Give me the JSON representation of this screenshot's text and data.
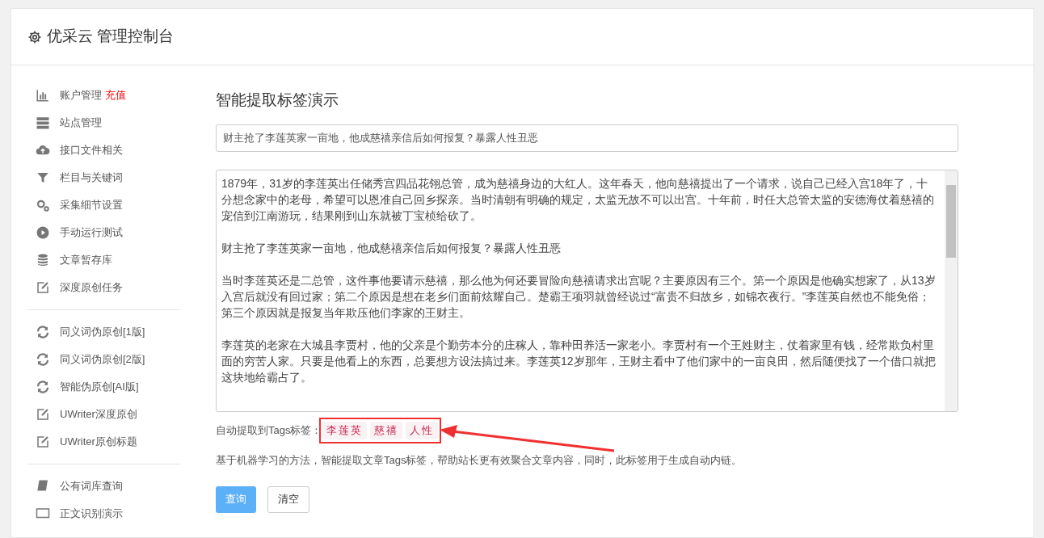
{
  "header": {
    "title": "优采云 管理控制台"
  },
  "sidebar": {
    "groups": [
      [
        {
          "label": "账户管理",
          "badge": "充值"
        },
        {
          "label": "站点管理"
        },
        {
          "label": "接口文件相关"
        },
        {
          "label": "栏目与关键词"
        },
        {
          "label": "采集细节设置"
        },
        {
          "label": "手动运行测试"
        },
        {
          "label": "文章暂存库"
        },
        {
          "label": "深度原创任务"
        }
      ],
      [
        {
          "label": "同义词伪原创[1版]"
        },
        {
          "label": "同义词伪原创[2版]"
        },
        {
          "label": "智能伪原创[AI版]"
        },
        {
          "label": "UWriter深度原创"
        },
        {
          "label": "UWriter原创标题"
        }
      ],
      [
        {
          "label": "公有词库查询"
        },
        {
          "label": "正文识别演示"
        }
      ]
    ]
  },
  "main": {
    "heading": "智能提取标签演示",
    "title_field": {
      "value": "财主抢了李莲英家一亩地，他成慈禧亲信后如何报复？暴露人性丑恶"
    },
    "content": [
      "1879年，31岁的李莲英出任储秀宫四品花翎总管，成为慈禧身边的大红人。这年春天，他向慈禧提出了一个请求，说自己已经入宫18年了，十分想念家中的老母，希望可以恩准自己回乡探亲。当时清朝有明确的规定，太监无故不可以出宫。十年前，时任大总管太监的安德海仗着慈禧的宠信到江南游玩，结果刚到山东就被丁宝桢给砍了。",
      "财主抢了李莲英家一亩地，他成慈禧亲信后如何报复？暴露人性丑恶",
      "当时李莲英还是二总管，这件事他要请示慈禧，那么他为何还要冒险向慈禧请求出宫呢？主要原因有三个。第一个原因是他确实想家了，从13岁入宫后就没有回过家；第二个原因是想在老乡们面前炫耀自己。楚霸王项羽就曾经说过“富贵不归故乡，如锦衣夜行。”李莲英自然也不能免俗；第三个原因就是报复当年欺压他们李家的王财主。",
      "李莲英的老家在大城县李贾村，他的父亲是个勤劳本分的庄稼人，靠种田养活一家老小。李贾村有一个王姓财主，仗着家里有钱，经常欺负村里面的穷苦人家。只要是他看上的东西，总要想方设法搞过来。李莲英12岁那年，王财主看中了他们家中的一亩良田，然后随便找了一个借口就把这块地给霸占了。"
    ],
    "tags_label": "自动提取到Tags标签：",
    "tags": [
      "李莲英",
      "慈禧",
      "人性"
    ],
    "description": "基于机器学习的方法，智能提取文章Tags标签，帮助站长更有效聚合文章内容，同时，此标签用于生成自动内链。",
    "buttons": [
      {
        "label": "查询",
        "kind": "primary"
      },
      {
        "label": "清空",
        "kind": "default"
      }
    ]
  }
}
